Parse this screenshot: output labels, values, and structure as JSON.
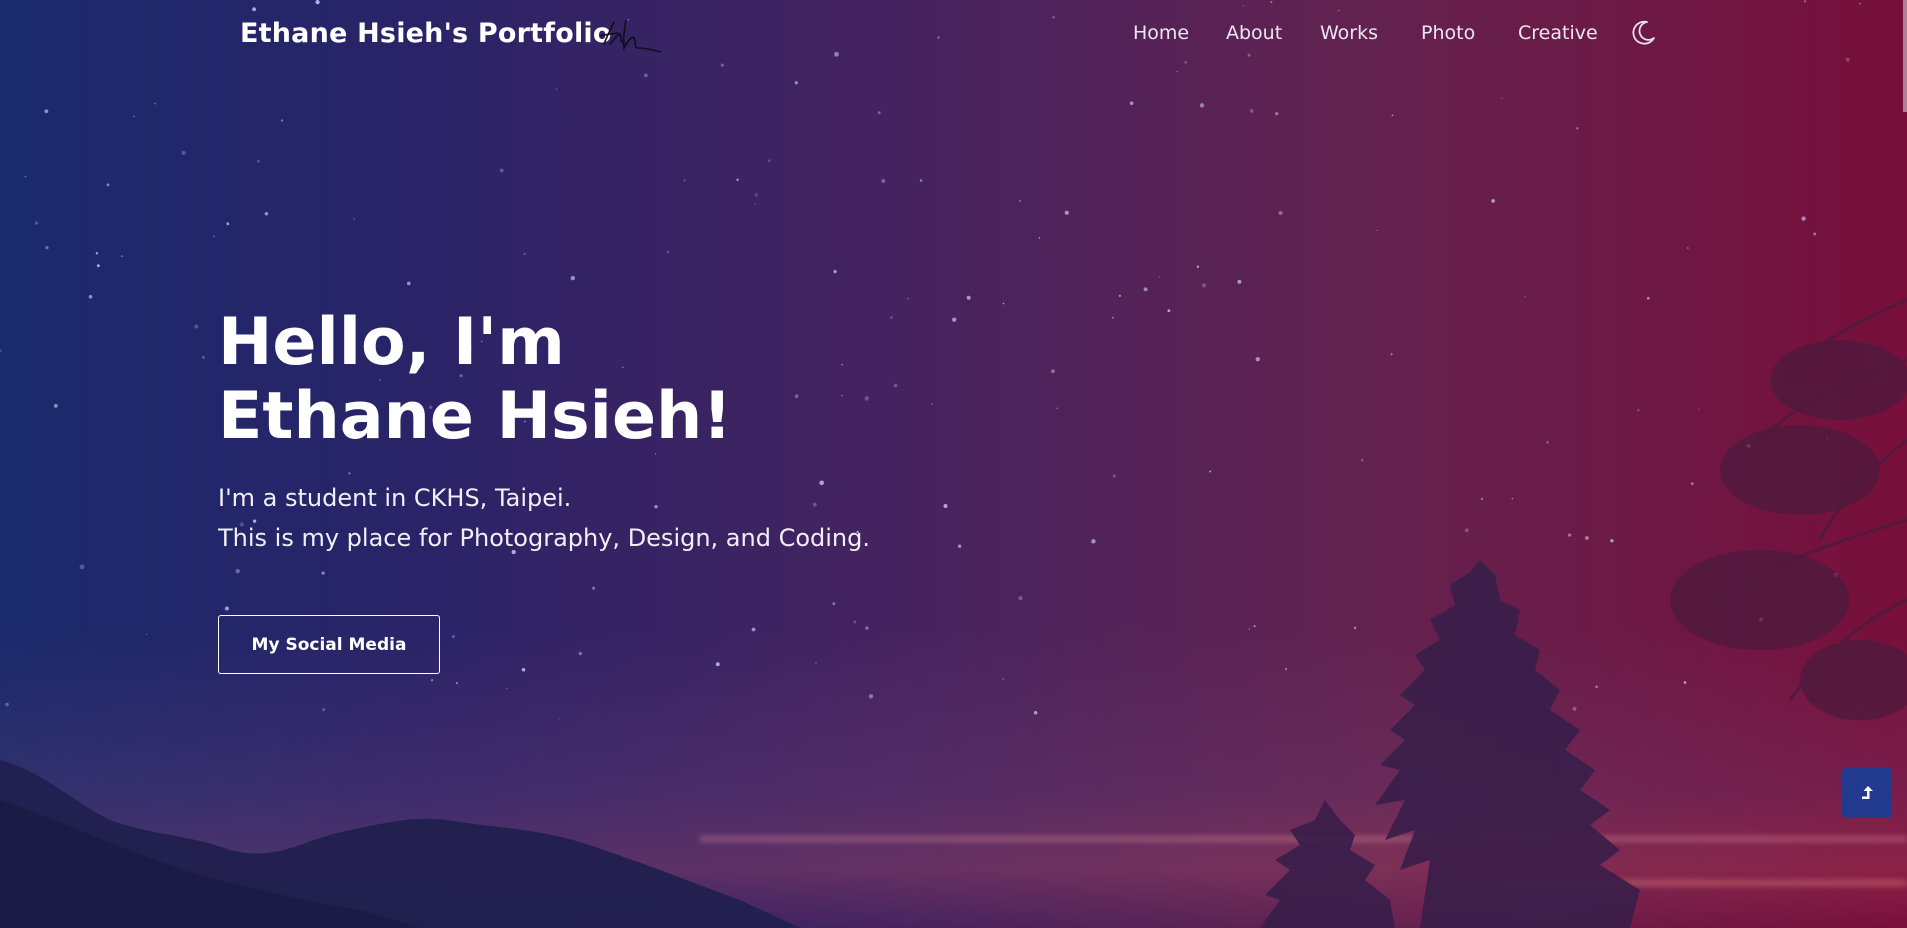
{
  "brand": {
    "title": "Ethane Hsieh's Portfolio",
    "signature_icon": "signature-logo"
  },
  "nav": {
    "items": [
      {
        "label": "Home"
      },
      {
        "label": "About"
      },
      {
        "label": "Works"
      },
      {
        "label": "Photo"
      },
      {
        "label": "Creative"
      }
    ],
    "theme_icon": "moon-icon"
  },
  "hero": {
    "line1": "Hello, I'm",
    "line2": "Ethane Hsieh!",
    "sub1": "I'm a student in CKHS, Taipei.",
    "sub2": "This is my place for Photography, Design, and Coding.",
    "cta_label": "My Social Media"
  },
  "scroll_top": {
    "icon": "arrow-up-icon"
  },
  "colors": {
    "gradient_left": "#1a2a6b",
    "gradient_mid": "#46235f",
    "gradient_right": "#780f3a",
    "scroll_button": "#213a8e",
    "text": "#ffffff"
  }
}
